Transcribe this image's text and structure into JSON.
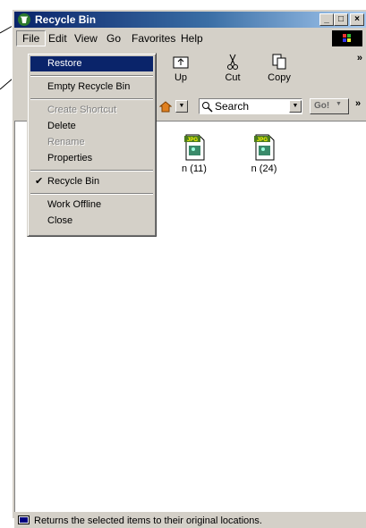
{
  "window": {
    "title": "Recycle Bin"
  },
  "menubar": [
    "File",
    "Edit",
    "View",
    "Go",
    "Favorites",
    "Help"
  ],
  "toolbar": {
    "up": "Up",
    "cut": "Cut",
    "copy": "Copy",
    "more": "»"
  },
  "addressbar": {
    "search_label": "Search",
    "go_label": "Go!",
    "more": "»"
  },
  "files": [
    {
      "name": "n (11)",
      "badge": "JPG"
    },
    {
      "name": "n (24)",
      "badge": "JPG"
    }
  ],
  "file_menu": {
    "restore": "Restore",
    "empty": "Empty Recycle Bin",
    "create_shortcut": "Create Shortcut",
    "delete": "Delete",
    "rename": "Rename",
    "properties": "Properties",
    "recycle_bin": "Recycle Bin",
    "work_offline": "Work Offline",
    "close": "Close",
    "check": "✔"
  },
  "status": {
    "text": "Returns the selected items to their original locations."
  }
}
